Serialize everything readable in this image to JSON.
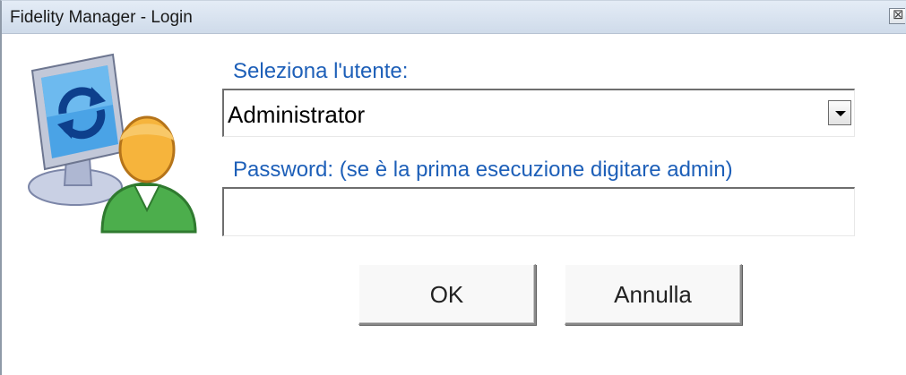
{
  "window": {
    "title": "Fidelity Manager - Login",
    "close_glyph": "⊠"
  },
  "icon": {
    "name": "user-computer-sync-icon"
  },
  "form": {
    "user_label": "Seleziona l'utente:",
    "user_selected": "Administrator",
    "password_label": "Password: (se è la prima esecuzione digitare admin)",
    "password_value": ""
  },
  "buttons": {
    "ok_label": "OK",
    "cancel_label": "Annulla"
  },
  "colors": {
    "label_blue": "#1d5fb8",
    "titlebar": "#dce6f2"
  }
}
